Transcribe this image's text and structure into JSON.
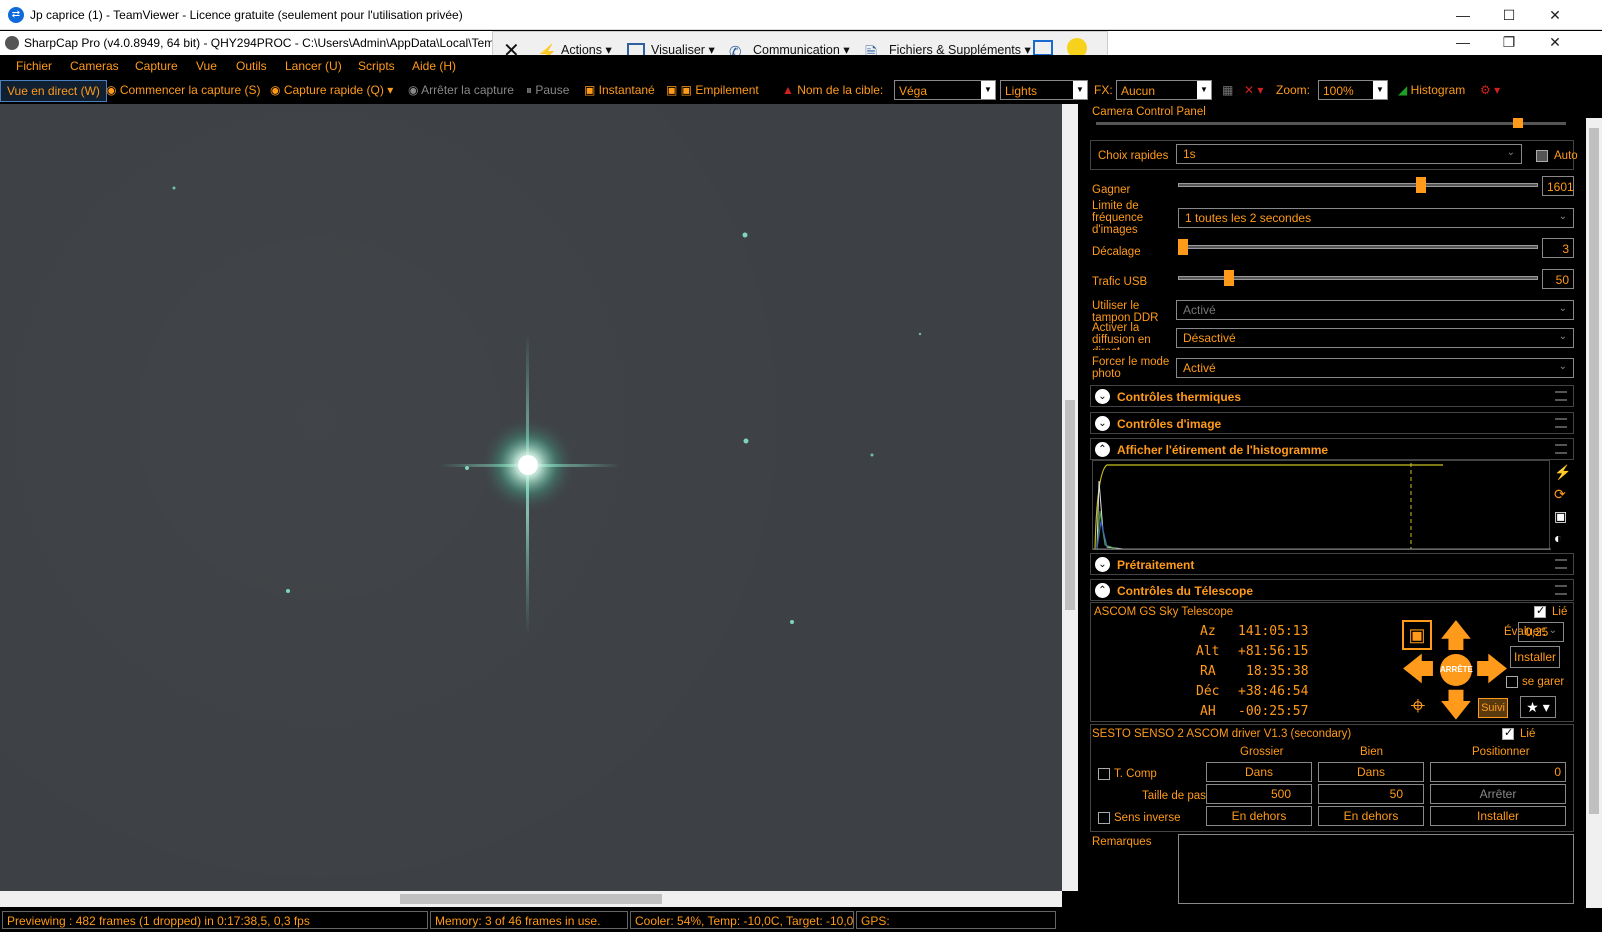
{
  "tv_window": {
    "title": "Jp caprice (1) - TeamViewer - Licence gratuite (seulement pour l'utilisation privée)"
  },
  "sc_window": {
    "title": "SharpCap Pro (v4.0.8949, 64 bit) - QHY294PROC - C:\\Users\\Admin\\AppData\\Local\\Temp\\"
  },
  "tv_toolbar": {
    "actions": "Actions",
    "view": "Visualiser",
    "communication": "Communication",
    "files": "Fichiers & Suppléments"
  },
  "menu": [
    "Fichier",
    "Cameras",
    "Capture",
    "Vue",
    "Outils",
    "Lancer (U)",
    "Scripts",
    "Aide (H)"
  ],
  "toolbar": {
    "live_view": "Vue en direct (W)",
    "start_capture": "Commencer la capture (S)",
    "quick_capture": "Capture rapide (Q)",
    "stop_capture": "Arrêter la capture",
    "pause": "Pause",
    "snapshot": "Instantané",
    "stacking": "Empilement",
    "target_label": "Nom de la cible:",
    "target_value": "Véga",
    "frame_type": "Lights",
    "fx_label": "FX:",
    "fx_value": "Aucun",
    "zoom_label": "Zoom:",
    "zoom_value": "100%",
    "histogram": "Histogram"
  },
  "status": {
    "preview": "Previewing : 482 frames (1 dropped) in 0:17:38,5, 0,3 fps",
    "memory": "Memory: 3 of 46 frames in use.",
    "cooler": "Cooler: 54%, Temp: -10,0C, Target: -10,0C",
    "gps": "GPS:"
  },
  "panel": {
    "title": "Camera Control Panel",
    "quick_choice_label": "Choix rapides",
    "quick_choice_value": "1s",
    "auto_label": "Auto",
    "gain_label": "Gagner",
    "gain_value": "1601",
    "gain_level": 0.68,
    "frame_limit_label": "Limite de fréquence d'images",
    "frame_limit_value": "1 toutes les 2 secondes",
    "offset_label": "Décalage",
    "offset_value": "3",
    "offset_level": 0.0,
    "usb_label": "Trafic USB",
    "usb_value": "50",
    "usb_level": 0.13,
    "ddr_label": "Utiliser le tampon DDR",
    "ddr_value": "Activé",
    "broadcast_label": "Activer la diffusion en direct",
    "broadcast_value": "Désactivé",
    "photo_label": "Forcer le mode photo",
    "photo_value": "Activé",
    "sections": {
      "thermal": "Contrôles thermiques",
      "image": "Contrôles d'image",
      "histogram": "Afficher l'étirement de l'histogramme",
      "preprocessing": "Prétraitement",
      "telescope": "Contrôles du Télescope"
    },
    "telescope": {
      "name": "ASCOM GS Sky Telescope",
      "linked": "Lié",
      "az_label": "Az",
      "az": "141:05:13",
      "alt_label": "Alt",
      "alt": "+81:56:15",
      "ra_label": "RA",
      "ra": "18:35:38",
      "dec_label": "Déc",
      "dec": "+38:46:54",
      "ha_label": "AH",
      "ha": "-00:25:57",
      "rate_label": "Évaluer:",
      "rate_value": "0,25",
      "install": "Installer",
      "park": "se garer",
      "stop": "ARRÊTE",
      "tracking": "Suivi"
    },
    "focuser": {
      "name": "SESTO SENSO 2 ASCOM driver V1.3 (secondary)",
      "linked": "Lié",
      "col_coarse": "Grossier",
      "col_fine": "Bien",
      "col_position": "Positionner",
      "tcomp": "T. Comp",
      "in_coarse": "Dans",
      "in_fine": "Dans",
      "position": "0",
      "step_label": "Taille de pas",
      "step_coarse": "500",
      "step_fine": "50",
      "stop": "Arrêter",
      "reverse": "Sens inverse",
      "out_coarse": "En dehors",
      "out_fine": "En dehors",
      "install": "Installer"
    },
    "remarks_label": "Remarques"
  },
  "colors": {
    "accent": "#ff9a1a",
    "sky": "#3d4145",
    "histogram_curve": "#c8c020"
  }
}
